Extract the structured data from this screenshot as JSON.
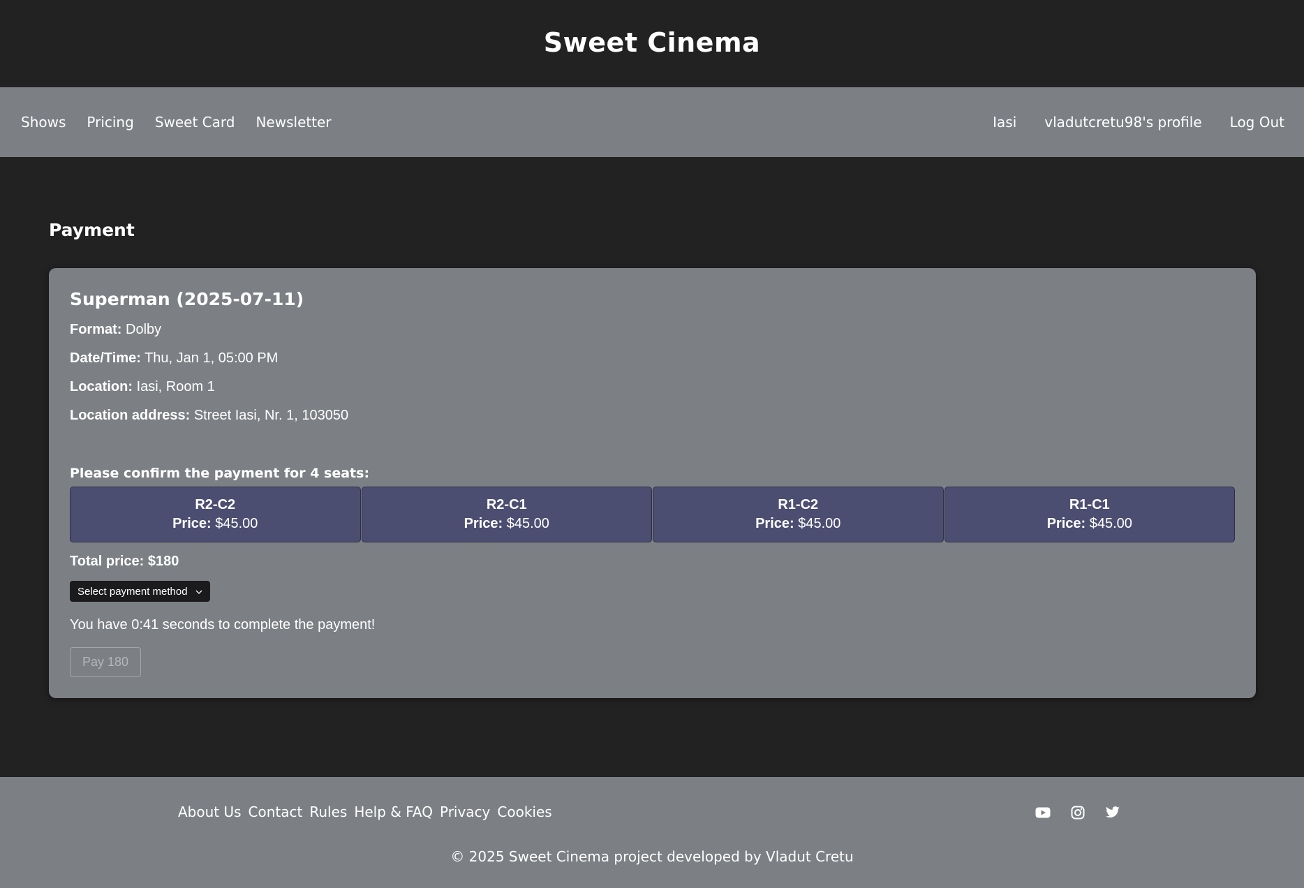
{
  "header": {
    "title": "Sweet Cinema"
  },
  "nav": {
    "left": [
      "Shows",
      "Pricing",
      "Sweet Card",
      "Newsletter"
    ],
    "right": [
      "Iasi",
      "vladutcretu98's profile",
      "Log Out"
    ]
  },
  "page": {
    "heading": "Payment"
  },
  "movie": {
    "title": "Superman (2025-07-11)",
    "details": [
      {
        "label": "Format:",
        "value": "Dolby"
      },
      {
        "label": "Date/Time:",
        "value": "Thu, Jan 1, 05:00 PM"
      },
      {
        "label": "Location:",
        "value": "Iasi, Room 1"
      },
      {
        "label": "Location address:",
        "value": "Street Iasi, Nr. 1, 103050"
      }
    ]
  },
  "confirm_text": "Please confirm the payment for 4 seats:",
  "seats": [
    {
      "code": "R2-C2",
      "price_label": "Price:",
      "price": "$45.00"
    },
    {
      "code": "R2-C1",
      "price_label": "Price:",
      "price": "$45.00"
    },
    {
      "code": "R1-C2",
      "price_label": "Price:",
      "price": "$45.00"
    },
    {
      "code": "R1-C1",
      "price_label": "Price:",
      "price": "$45.00"
    }
  ],
  "total_price": "Total price: $180",
  "payment_method": {
    "selected": "Select payment method",
    "icon": "chevron-down-icon"
  },
  "timer_text": "You have 0:41 seconds to complete the payment!",
  "pay_button": "Pay 180",
  "footer": {
    "links": [
      "About Us",
      "Contact",
      "Rules",
      "Help & FAQ",
      "Privacy",
      "Cookies"
    ],
    "social": [
      "youtube-icon",
      "instagram-icon",
      "twitter-icon"
    ],
    "copyright": "© 2025 Sweet Cinema project developed by Vladut Cretu"
  },
  "colors": {
    "background": "#222222",
    "bar": "#7c7f84",
    "seat_card": "#4b4e70",
    "select_bg": "#1b1b1d"
  }
}
